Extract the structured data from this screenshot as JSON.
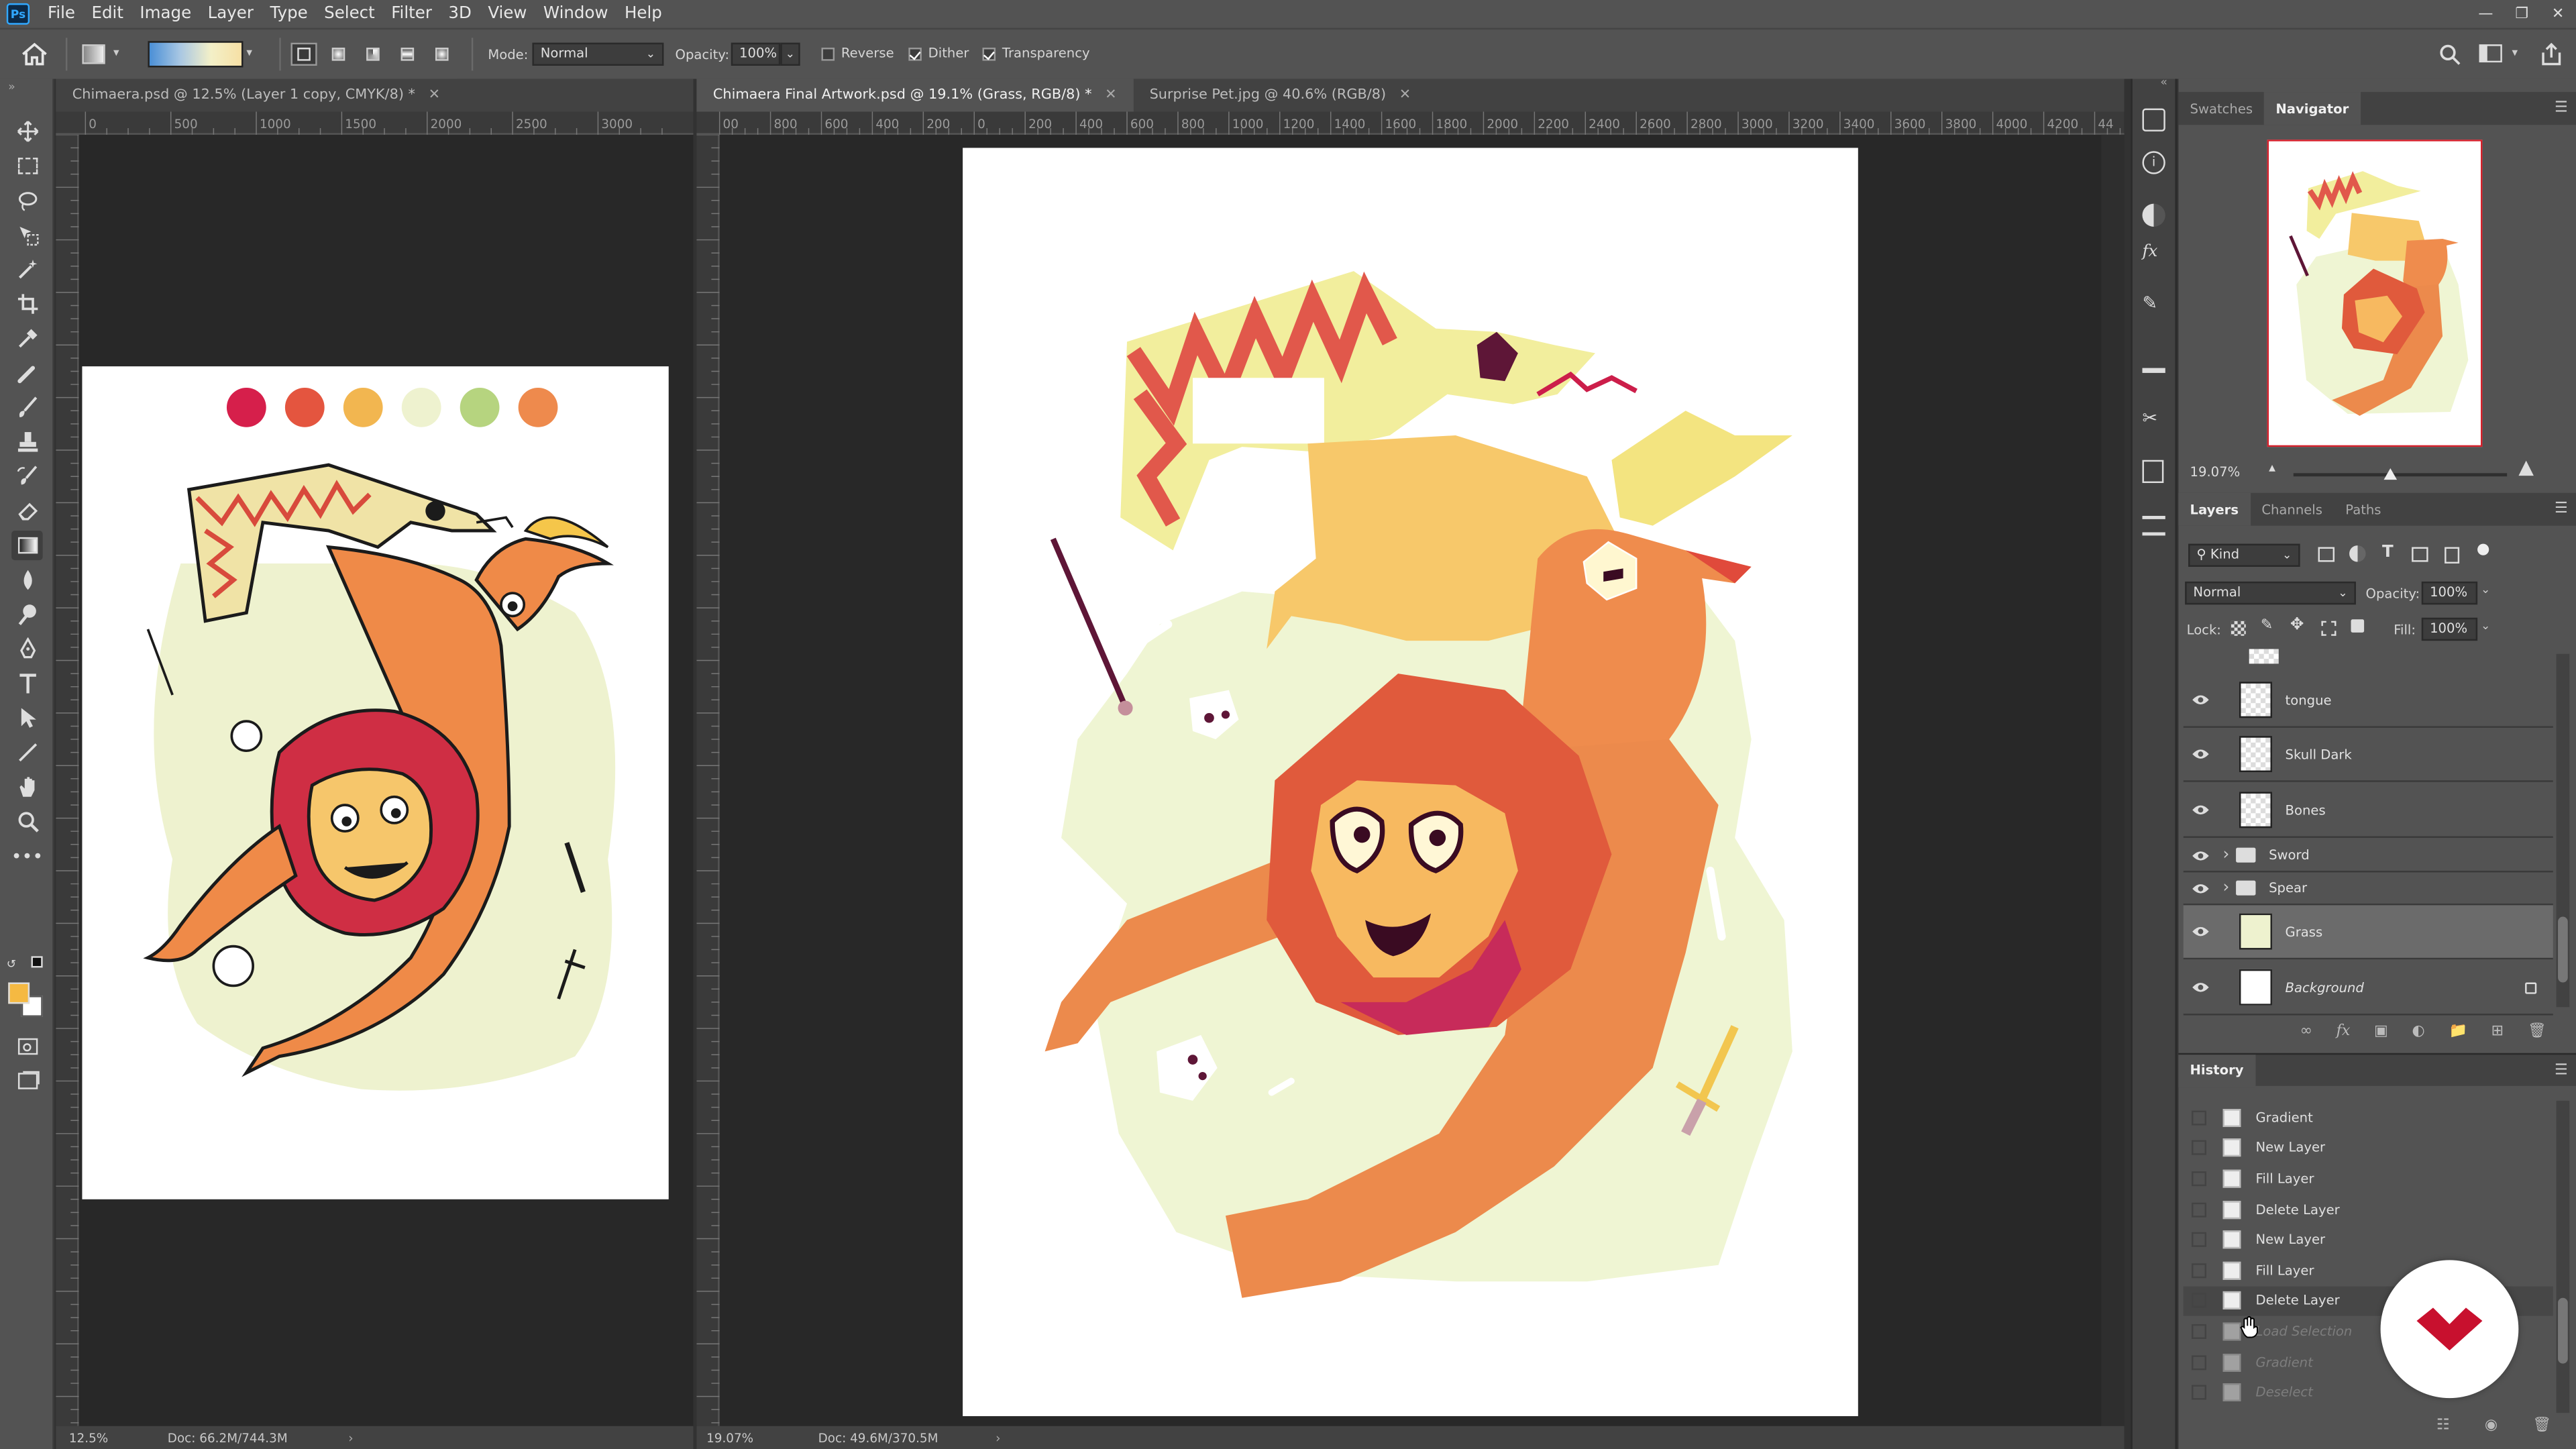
{
  "app": {
    "logo": "Ps"
  },
  "menu": [
    "File",
    "Edit",
    "Image",
    "Layer",
    "Type",
    "Select",
    "Filter",
    "3D",
    "View",
    "Window",
    "Help"
  ],
  "options": {
    "mode_label": "Mode:",
    "mode_value": "Normal",
    "opacity_label": "Opacity:",
    "opacity_value": "100%",
    "reverse": "Reverse",
    "dither": "Dither",
    "transparency": "Transparency",
    "reverse_checked": false,
    "dither_checked": true,
    "transparency_checked": true
  },
  "tabs": {
    "left": {
      "title": "Chimaera.psd @ 12.5% (Layer 1 copy, CMYK/8) *"
    },
    "right": [
      {
        "title": "Chimaera Final Artwork.psd @ 19.1% (Grass, RGB/8) *",
        "active": true
      },
      {
        "title": "Surprise Pet.jpg @ 40.6% (RGB/8)",
        "active": false
      }
    ]
  },
  "rulers": {
    "left_h": [
      "0",
      "500",
      "1000",
      "1500",
      "2000",
      "2500",
      "3000"
    ],
    "right_h": [
      "00",
      "800",
      "600",
      "400",
      "200",
      "0",
      "200",
      "400",
      "600",
      "800",
      "1000",
      "1200",
      "1400",
      "1600",
      "1800",
      "2000",
      "2200",
      "2400",
      "2600",
      "2800",
      "3000",
      "3200",
      "3400",
      "3600",
      "3800",
      "4000",
      "4200",
      "44"
    ]
  },
  "status": {
    "left_zoom": "12.5%",
    "left_doc": "Doc: 66.2M/744.3M",
    "right_zoom": "19.07%",
    "right_doc": "Doc: 49.6M/370.5M"
  },
  "navigator": {
    "tabs": [
      "Swatches",
      "Navigator"
    ],
    "zoom": "19.07%",
    "zoom_fraction": 0.45
  },
  "layers_panel": {
    "tabs": [
      "Layers",
      "Channels",
      "Paths"
    ],
    "kind_label": "Kind",
    "blend_mode": "Normal",
    "opacity_label": "Opacity:",
    "opacity_value": "100%",
    "lock_label": "Lock:",
    "fill_label": "Fill:",
    "fill_value": "100%",
    "layers": [
      {
        "name": "tongue",
        "type": "checker"
      },
      {
        "name": "Skull Dark",
        "type": "checker"
      },
      {
        "name": "Bones",
        "type": "checker"
      },
      {
        "name": "Sword",
        "type": "group"
      },
      {
        "name": "Spear",
        "type": "group"
      },
      {
        "name": "Grass",
        "type": "grass",
        "selected": true
      },
      {
        "name": "Background",
        "type": "white",
        "locked": true
      }
    ]
  },
  "history": {
    "title": "History",
    "items": [
      {
        "name": "Gradient",
        "dim": false
      },
      {
        "name": "New Layer",
        "dim": false
      },
      {
        "name": "Fill Layer",
        "dim": false
      },
      {
        "name": "Delete Layer",
        "dim": false
      },
      {
        "name": "New Layer",
        "dim": false
      },
      {
        "name": "Fill Layer",
        "dim": false
      },
      {
        "name": "Delete Layer",
        "dim": false,
        "current": true
      },
      {
        "name": "Load Selection",
        "dim": true
      },
      {
        "name": "Gradient",
        "dim": true
      },
      {
        "name": "Deselect",
        "dim": true
      }
    ]
  },
  "colors": {
    "menubar": "#535353",
    "canvas_bg": "#282828",
    "accent_red": "#c8102e",
    "foreground_swatch": "#f5b942",
    "background_swatch": "#ffffff"
  },
  "palette_swatches": [
    "#d61f4b",
    "#e4553f",
    "#f2b650",
    "#eef2cf",
    "#b6d47f",
    "#ee8a4d"
  ]
}
